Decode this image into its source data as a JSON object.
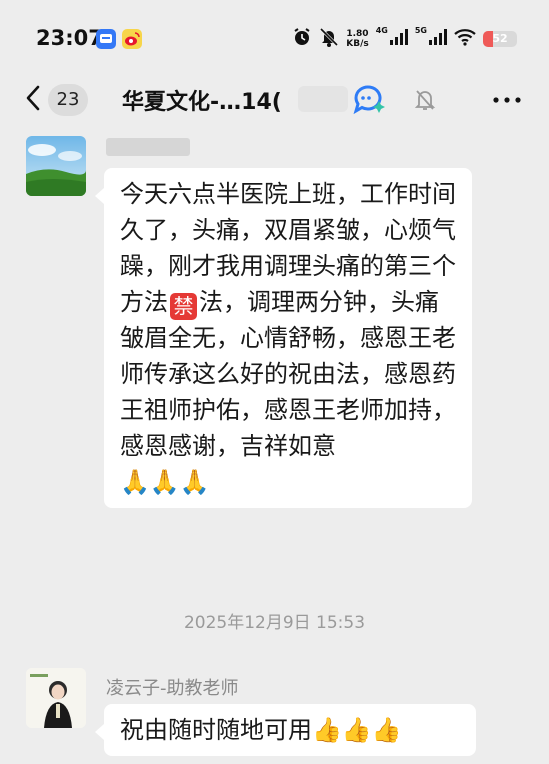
{
  "status_bar": {
    "time": "23:07",
    "net_speed_value": "1.80",
    "net_speed_unit": "KB/s",
    "net_tag_4g": "4G",
    "net_tag_5g": "5G",
    "battery_text": "52",
    "battery_level": 0.3,
    "icons": [
      "alarm-icon",
      "mute-bell-icon",
      "signal-icon",
      "wifi-icon",
      "battery-icon"
    ]
  },
  "header": {
    "back_count": "23",
    "title": "华夏文化-…14(",
    "title_suffix": ")",
    "icons": [
      "back-chevron-icon",
      "ai-chat-icon",
      "mute-bell-icon",
      "more-icon"
    ]
  },
  "messages": [
    {
      "sender": "",
      "text_before_emoji": "今天六点半医院上班，工作时间久了，头痛，双眉紧皱，心烦气躁，刚才我用调理头痛的第三个方法",
      "inline_emoji": "禁",
      "text_after_emoji": "法，调理两分钟，头痛皱眉全无，心情舒畅，感恩王老师传承这么好的祝由法，感恩药王祖师护佑，感恩王老师加持，感恩感谢，吉祥如意",
      "trailing_emoji": "🙏🙏🙏"
    },
    {
      "sender": "凌云子-助教老师",
      "text": "祝由随时随地可用",
      "trailing_emoji": "👍👍👍"
    }
  ],
  "timestamp": "2025年12月9日 15:53",
  "colors": {
    "background": "#ededed",
    "bubble": "#ffffff",
    "meta_text": "#9a9a9a",
    "battery_low": "#ef5a58",
    "ban_badge": "#e53935"
  }
}
